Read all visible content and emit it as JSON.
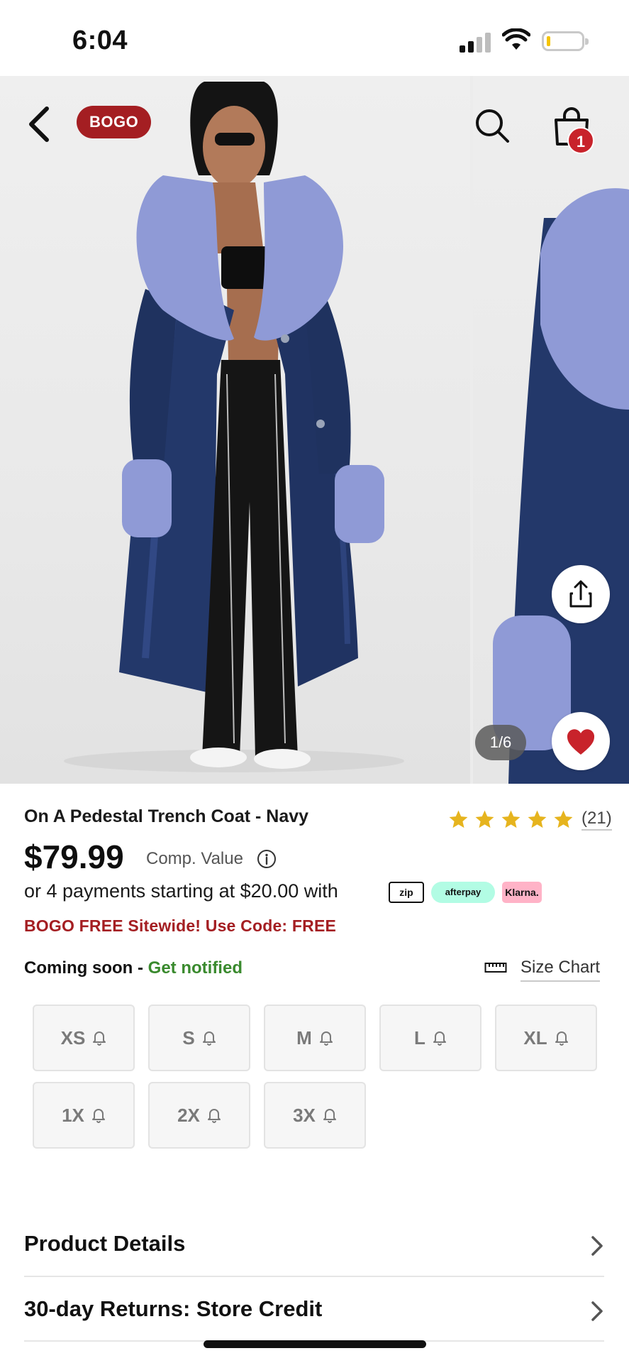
{
  "status_bar": {
    "time": "6:04"
  },
  "header": {
    "badge": "BOGO",
    "cart_count": "1"
  },
  "gallery": {
    "pager": "1/6"
  },
  "product": {
    "title": "On A Pedestal Trench Coat - Navy",
    "rating_stars": 5,
    "rating_count": "(21)",
    "price": "$79.99",
    "comp_value_label": "Comp. Value",
    "installments_text": "or 4 payments starting at $20.00 with",
    "payment_providers": {
      "zip": "zip",
      "afterpay": "afterpay",
      "klarna": "Klarna."
    },
    "promo": "BOGO FREE Sitewide! Use Code: FREE"
  },
  "sizes": {
    "status": "Coming soon - ",
    "notify_link": "Get notified",
    "size_chart": "Size Chart",
    "options": [
      "XS",
      "S",
      "M",
      "L",
      "XL",
      "1X",
      "2X",
      "3X"
    ]
  },
  "accordions": [
    {
      "label": "Product Details"
    },
    {
      "label": "30-day Returns: Store Credit"
    }
  ],
  "colors": {
    "brand_red": "#a41e22",
    "badge_red": "#c8232b",
    "notify_green": "#3a8a2e",
    "star_gold": "#e6b41e",
    "coat_navy": "#23386a",
    "fur_lavender": "#8f9ad6"
  }
}
